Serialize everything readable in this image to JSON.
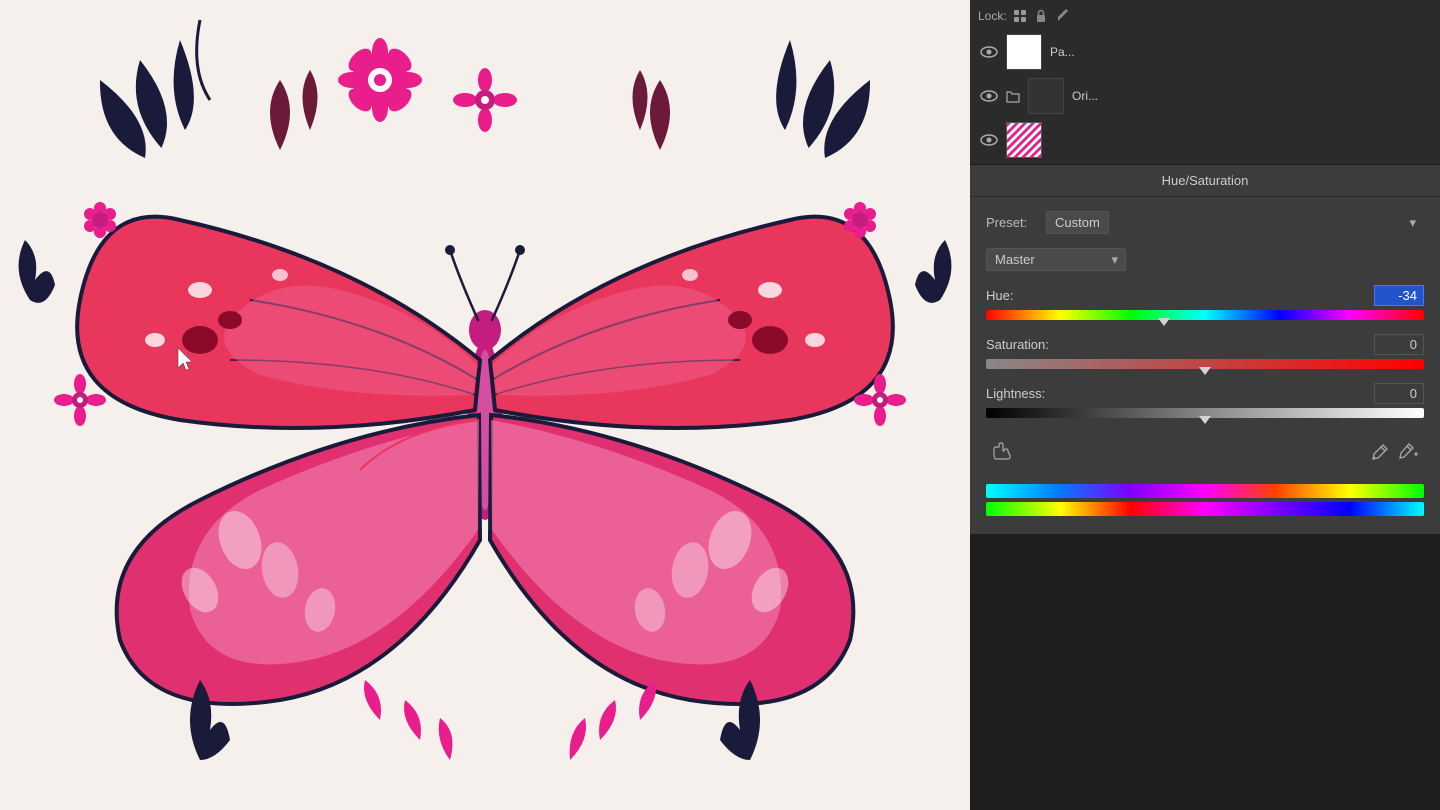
{
  "panel": {
    "title": "Hue/Saturation",
    "preset_label": "Preset:",
    "preset_value": "Custom",
    "channel_value": "Master",
    "hue_label": "Hue:",
    "hue_value": "-34",
    "saturation_label": "Saturation:",
    "saturation_value": "0",
    "lightness_label": "Lightness:",
    "lightness_value": "0",
    "hue_thumb_pct": "40.6",
    "sat_thumb_pct": "50",
    "light_thumb_pct": "50"
  },
  "layers": {
    "lock_label": "Lock:",
    "layer1_name": "Pa...",
    "layer2_name": "Ori..."
  },
  "toolbar": {
    "hand_icon": "✋",
    "eyedropper_icon": "🖱",
    "eyedropper2_icon": "⊕"
  }
}
